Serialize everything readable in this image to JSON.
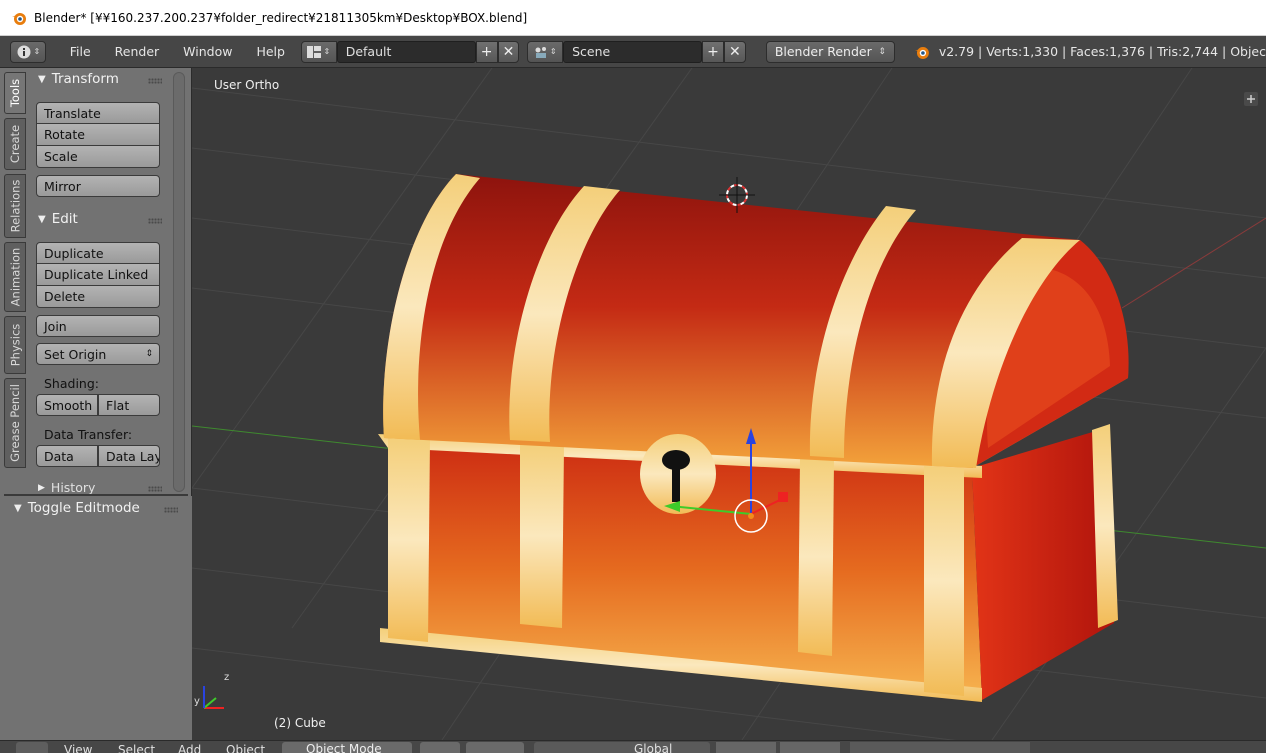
{
  "window": {
    "title": "Blender* [¥¥160.237.200.237¥folder_redirect¥21811305km¥Desktop¥BOX.blend]"
  },
  "infobar": {
    "menus": [
      "File",
      "Render",
      "Window",
      "Help"
    ],
    "layout": "Default",
    "scene": "Scene",
    "engine": "Blender Render",
    "stats": "v2.79 | Verts:1,330 | Faces:1,376 | Tris:2,744 | Objec"
  },
  "toolshelf": {
    "tabs": [
      "Tools",
      "Create",
      "Relations",
      "Animation",
      "Physics",
      "Grease Pencil"
    ],
    "transform": {
      "header": "Transform",
      "buttons": [
        "Translate",
        "Rotate",
        "Scale"
      ],
      "mirror": "Mirror"
    },
    "edit": {
      "header": "Edit",
      "buttons": [
        "Duplicate",
        "Duplicate Linked",
        "Delete"
      ],
      "join": "Join",
      "set_origin": "Set Origin",
      "shading_label": "Shading:",
      "shading_buttons": [
        "Smooth",
        "Flat"
      ],
      "data_transfer_label": "Data Transfer:",
      "data_transfer_buttons": [
        "Data",
        "Data Lay"
      ]
    },
    "history": "History",
    "operator": "Toggle Editmode"
  },
  "viewport": {
    "view_label": "User Ortho",
    "object_label": "(2) Cube",
    "axis_x": "x",
    "axis_y": "y",
    "axis_z": "z"
  },
  "bottombar": {
    "items": [
      "View",
      "Select",
      "Add",
      "Object",
      "Object Mode",
      "Global"
    ]
  },
  "colors": {
    "chest_red": "#c41f12",
    "chest_gold": "#f2c262",
    "viewport_bg": "#3a3a3a"
  }
}
